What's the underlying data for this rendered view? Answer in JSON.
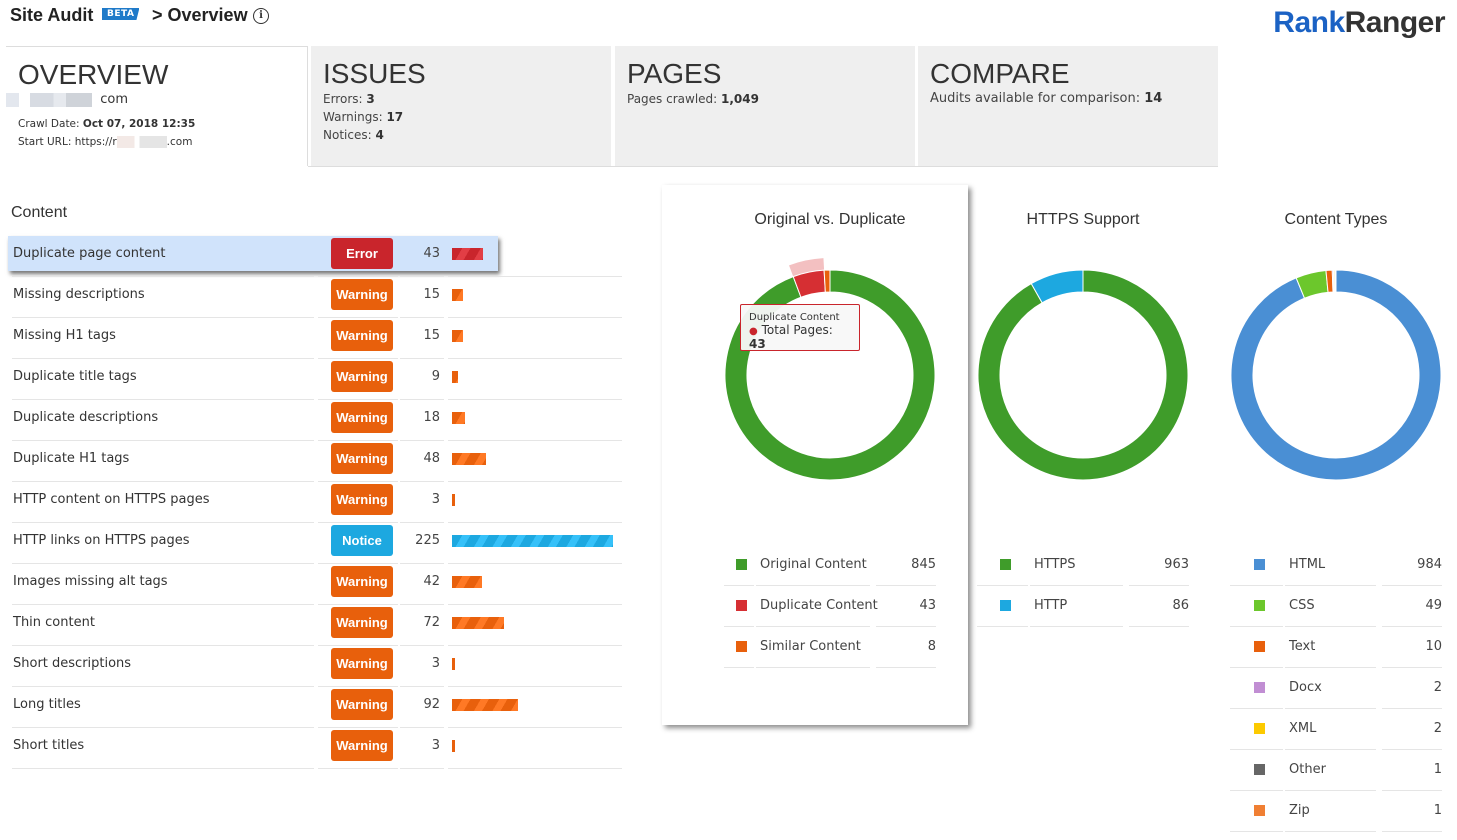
{
  "header": {
    "title": "Site Audit",
    "beta": "BETA",
    "breadcrumb": "> Overview",
    "info_icon": "info-icon",
    "logo_part1": "Rank",
    "logo_part2": "Ranger"
  },
  "cards": {
    "overview": {
      "title": "OVERVIEW",
      "domain_suffix": "com",
      "crawl_date_label": "Crawl Date: ",
      "crawl_date": "Oct 07, 2018 12:35",
      "start_url_label": "Start URL: https://r",
      "start_url_suffix": ".com"
    },
    "issues": {
      "title": "ISSUES",
      "errors_label": "Errors: ",
      "errors": "3",
      "warnings_label": "Warnings: ",
      "warnings": "17",
      "notices_label": "Notices: ",
      "notices": "4"
    },
    "pages": {
      "title": "PAGES",
      "crawled_label": "Pages crawled: ",
      "crawled": "1,049"
    },
    "compare": {
      "title": "COMPARE",
      "audits_label": "Audits available for comparison: ",
      "audits": "14"
    }
  },
  "content": {
    "heading": "Content",
    "colors": {
      "Error": "#c9252c",
      "Warning": "#e8600c",
      "Notice": "#1da8e0"
    },
    "bar_max": 225,
    "rows": [
      {
        "label": "Duplicate page content",
        "severity": "Error",
        "count": 43,
        "highlighted": true
      },
      {
        "label": "Missing descriptions",
        "severity": "Warning",
        "count": 15
      },
      {
        "label": "Missing H1 tags",
        "severity": "Warning",
        "count": 15
      },
      {
        "label": "Duplicate title tags",
        "severity": "Warning",
        "count": 9
      },
      {
        "label": "Duplicate descriptions",
        "severity": "Warning",
        "count": 18
      },
      {
        "label": "Duplicate H1 tags",
        "severity": "Warning",
        "count": 48
      },
      {
        "label": "HTTP content on HTTPS pages",
        "severity": "Warning",
        "count": 3
      },
      {
        "label": "HTTP links on HTTPS pages",
        "severity": "Notice",
        "count": 225
      },
      {
        "label": "Images missing alt tags",
        "severity": "Warning",
        "count": 42
      },
      {
        "label": "Thin content",
        "severity": "Warning",
        "count": 72
      },
      {
        "label": "Short descriptions",
        "severity": "Warning",
        "count": 3
      },
      {
        "label": "Long titles",
        "severity": "Warning",
        "count": 92
      },
      {
        "label": "Short titles",
        "severity": "Warning",
        "count": 3
      }
    ]
  },
  "chart_data": [
    {
      "type": "pie",
      "donut": true,
      "title": "Original vs. Duplicate",
      "categories": [
        "Original Content",
        "Duplicate Content",
        "Similar Content"
      ],
      "values": [
        845,
        43,
        8
      ],
      "colors": [
        "#3f9c2a",
        "#d62f33",
        "#e8600c"
      ],
      "hovered": "Duplicate Content",
      "tooltip": {
        "title": "Duplicate Content",
        "label": "Total Pages: ",
        "value": "43"
      }
    },
    {
      "type": "pie",
      "donut": true,
      "title": "HTTPS Support",
      "categories": [
        "HTTPS",
        "HTTP"
      ],
      "values": [
        963,
        86
      ],
      "colors": [
        "#3f9c2a",
        "#1da8e0"
      ]
    },
    {
      "type": "pie",
      "donut": true,
      "title": "Content Types",
      "categories": [
        "HTML",
        "CSS",
        "Text",
        "Docx",
        "XML",
        "Other",
        "Zip"
      ],
      "values": [
        984,
        49,
        10,
        2,
        2,
        1,
        1
      ],
      "colors": [
        "#4a8fd4",
        "#6cc72c",
        "#e8600c",
        "#c18ed3",
        "#fcca00",
        "#666666",
        "#f07f33"
      ]
    }
  ]
}
